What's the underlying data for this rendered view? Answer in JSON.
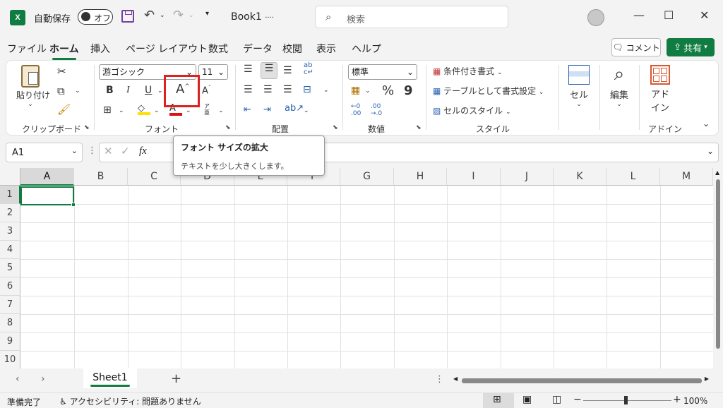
{
  "titlebar": {
    "logo": "X",
    "autosave_label": "自動保存",
    "toggle_label": "オフ",
    "book_title": "Book1",
    "book_title_suffix": "····",
    "search_placeholder": "検索",
    "min": "—",
    "max": "☐",
    "close": "✕"
  },
  "tabs": [
    "ファイル",
    "ホーム",
    "挿入",
    "ページ レイアウト",
    "数式",
    "データ",
    "校閲",
    "表示",
    "ヘルプ"
  ],
  "comment_label": "コメント",
  "share_label": "共有",
  "ribbon": {
    "clipboard": {
      "paste": "貼り付け",
      "label": "クリップボード"
    },
    "font": {
      "font_name": "游ゴシック",
      "font_size": "11",
      "bold": "B",
      "italic": "I",
      "underline": "U",
      "grow": "A",
      "shrink": "A",
      "label": "フォント"
    },
    "alignment": {
      "label": "配置"
    },
    "number": {
      "format": "標準",
      "percent": "%",
      "comma": "9",
      "label": "数値"
    },
    "styles": {
      "conditional": "条件付き書式",
      "table": "テーブルとして書式設定",
      "cell_style": "セルのスタイル",
      "label": "スタイル"
    },
    "cells": {
      "label": "セル"
    },
    "edit": {
      "label": "編集"
    },
    "addins": {
      "label1": "アド",
      "label2": "イン",
      "group": "アドイン"
    }
  },
  "formula": {
    "namebox": "A1",
    "fx": "fx"
  },
  "tooltip": {
    "title": "フォント サイズの拡大",
    "body": "テキストを少し大きくします。"
  },
  "columns": [
    "A",
    "B",
    "C",
    "D",
    "E",
    "F",
    "G",
    "H",
    "I",
    "J",
    "K",
    "L",
    "M"
  ],
  "rows": [
    "1",
    "2",
    "3",
    "4",
    "5",
    "6",
    "7",
    "8",
    "9",
    "10"
  ],
  "sheet": {
    "name": "Sheet1",
    "add": "+"
  },
  "status": {
    "ready": "準備完了",
    "accessibility": "アクセシビリティ: 問題ありません",
    "zoom": "100%"
  }
}
